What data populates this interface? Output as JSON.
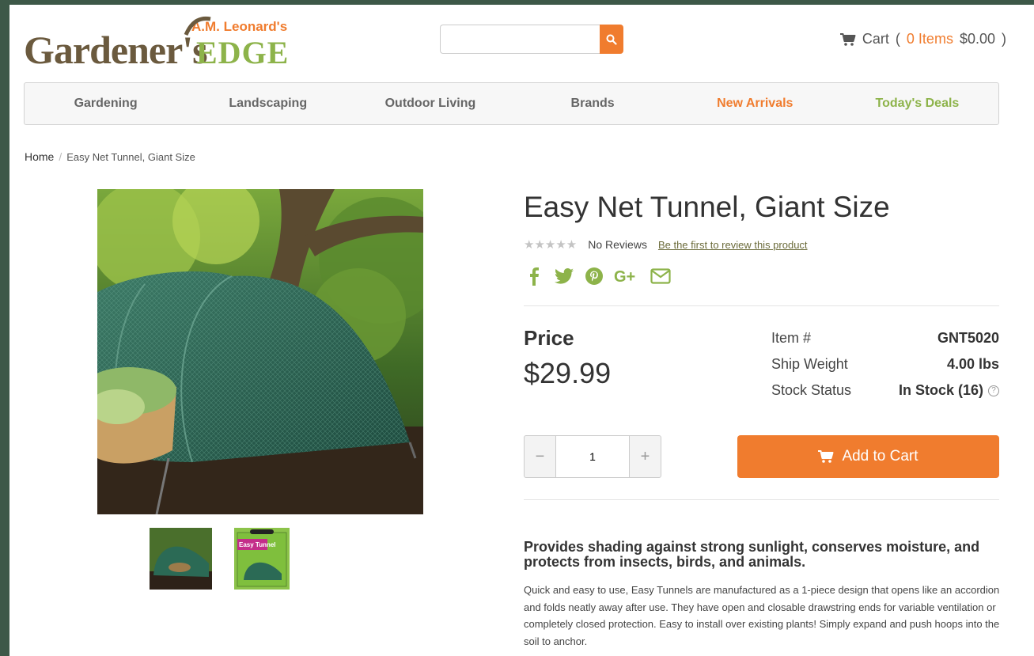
{
  "header": {
    "logo_main": "Gardener's",
    "logo_brand": "A.M. Leonard's",
    "logo_edge": "EDGE",
    "search": {
      "placeholder": "",
      "icon": "search-icon"
    },
    "cart": {
      "label": "Cart",
      "open": "(",
      "count": "0 Items",
      "total": "$0.00",
      "close": ")",
      "icon": "cart-icon"
    }
  },
  "nav": {
    "items": [
      {
        "label": "Gardening"
      },
      {
        "label": "Landscaping"
      },
      {
        "label": "Outdoor Living"
      },
      {
        "label": "Brands"
      },
      {
        "label": "New Arrivals",
        "color": "#f07c2e"
      },
      {
        "label": "Today's Deals",
        "color": "#8db34a"
      }
    ]
  },
  "breadcrumb": {
    "home": "Home",
    "separator": "/",
    "current": "Easy Net Tunnel, Giant Size"
  },
  "product": {
    "title": "Easy Net Tunnel, Giant Size",
    "rating": {
      "stars": "★★★★★",
      "value": 0,
      "max": 5
    },
    "no_reviews": "No Reviews",
    "review_link": "Be the first to review this product",
    "social_icons": [
      "facebook-icon",
      "twitter-icon",
      "pinterest-icon",
      "google-plus-icon",
      "email-icon"
    ],
    "price_label": "Price",
    "price": "$29.99",
    "specs": [
      {
        "key": "Item #",
        "value": "GNT5020"
      },
      {
        "key": "Ship Weight",
        "value": "4.00 lbs"
      },
      {
        "key": "Stock Status",
        "value": "In Stock (16)"
      }
    ],
    "help_glyph": "?",
    "quantity": "1",
    "minus": "−",
    "plus": "+",
    "add_to_cart": "Add to Cart",
    "thumb_box_text": "Easy Tunnel",
    "description_heading": "Provides shading against strong sunlight, conserves moisture, and protects from insects, birds, and animals.",
    "description": "Quick and easy to use, Easy Tunnels are manufactured as a 1-piece design that opens like an accordion and folds neatly away after use. They have open and closable drawstring ends for variable ventilation or completely closed protection. Easy to install over existing plants! Simply expand and push hoops into the soil to anchor."
  },
  "colors": {
    "accent": "#f07c2e",
    "green": "#8db34a",
    "logo_brown": "#6b5a3e",
    "frame": "#3d5848"
  }
}
